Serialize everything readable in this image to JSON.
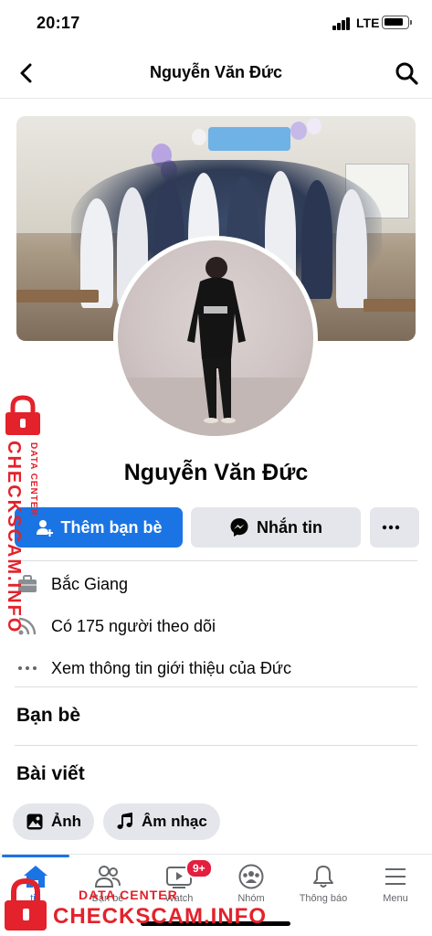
{
  "status_bar": {
    "time": "20:17",
    "network": "LTE"
  },
  "header": {
    "title": "Nguyễn Văn Đức"
  },
  "profile": {
    "name": "Nguyễn Văn Đức"
  },
  "actions": {
    "add_friend_label": "Thêm bạn bè",
    "message_label": "Nhắn tin",
    "more_label": "···"
  },
  "info": {
    "location": "Bắc Giang",
    "followers": "Có 175 người theo dõi",
    "about_link": "Xem thông tin giới thiệu của Đức"
  },
  "sections": {
    "friends": "Bạn bè",
    "posts": "Bài viết"
  },
  "chips": [
    {
      "label": "Ảnh",
      "icon": "photo-icon"
    },
    {
      "label": "Âm nhạc",
      "icon": "music-note-icon"
    }
  ],
  "tabbar": {
    "items": [
      {
        "label": "tin",
        "icon": "home-icon",
        "active": true
      },
      {
        "label": "Bạn bè",
        "icon": "friends-icon"
      },
      {
        "label": "Watch",
        "icon": "watch-icon",
        "badge": "9+"
      },
      {
        "label": "Nhóm",
        "icon": "groups-icon"
      },
      {
        "label": "Thông báo",
        "icon": "bell-icon"
      },
      {
        "label": "Menu",
        "icon": "menu-icon"
      }
    ]
  },
  "watermark": {
    "brand": "CHECKSCAM.INFO",
    "tagline": "DATA CENTER"
  },
  "colors": {
    "accent": "#1b74e4",
    "badge": "#e41e3f",
    "watermark": "#e3222b"
  }
}
